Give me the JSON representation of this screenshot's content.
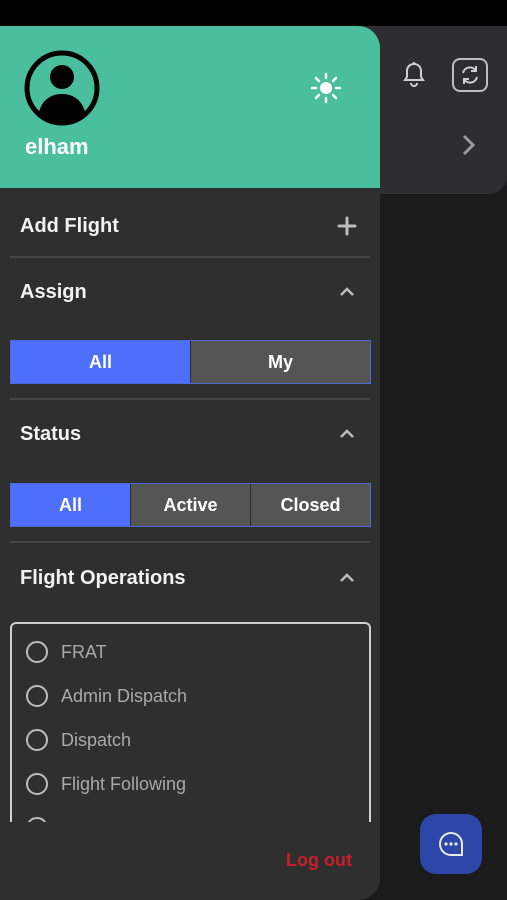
{
  "header": {
    "username": "elham",
    "theme_icon": "sun-icon",
    "avatar_icon": "user-avatar-icon"
  },
  "sections": {
    "add_flight": {
      "label": "Add Flight",
      "icon": "plus-icon"
    },
    "assign": {
      "label": "Assign",
      "icon": "chevron-up-icon",
      "options": [
        "All",
        "My"
      ],
      "selected": "All"
    },
    "status": {
      "label": "Status",
      "icon": "chevron-up-icon",
      "options": [
        "All",
        "Active",
        "Closed"
      ],
      "selected": "All"
    },
    "flight_operations": {
      "label": "Flight Operations",
      "icon": "chevron-up-icon",
      "items": [
        "FRAT",
        "Admin Dispatch",
        "Dispatch",
        "Flight Following"
      ]
    }
  },
  "footer": {
    "logout_label": "Log out"
  },
  "background": {
    "icons": [
      "bell-icon",
      "refresh-icon",
      "chevron-right-icon",
      "chat-icon"
    ]
  },
  "colors": {
    "header_bg": "#4abf9e",
    "drawer_bg": "#2f2f30",
    "active_segment": "#4d6ffc",
    "inactive_segment": "#555556",
    "logout": "#c81e2b",
    "chat_button": "#2d47a8"
  }
}
